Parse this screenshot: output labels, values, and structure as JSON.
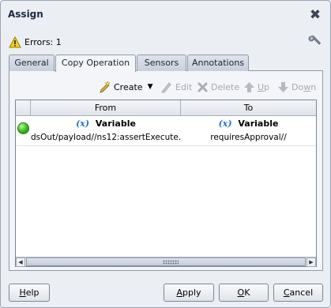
{
  "dialog": {
    "title": "Assign",
    "errors_label": "Errors: 1"
  },
  "tabs": [
    {
      "label": "General",
      "active": false
    },
    {
      "label": "Copy Operation",
      "active": true
    },
    {
      "label": "Sensors",
      "active": false
    },
    {
      "label": "Annotations",
      "active": false
    }
  ],
  "toolbar": {
    "create": {
      "label": "Create",
      "icon": "create-icon"
    },
    "edit": {
      "label": "Edit",
      "icon": "pencil-icon",
      "enabled": false
    },
    "delete": {
      "label": "Delete",
      "icon": "delete-icon",
      "enabled": false
    },
    "up": {
      "label": "Up",
      "icon": "arrow-up-icon",
      "enabled": false
    },
    "down": {
      "label": "Down",
      "icon": "arrow-down-icon",
      "enabled": false
    }
  },
  "table": {
    "columns": [
      "From",
      "To"
    ],
    "rows": [
      {
        "status": "valid",
        "from": {
          "type_icon": "(x)",
          "type": "Variable",
          "path": "dsOut/payload//ns12:assertExecute..."
        },
        "to": {
          "type_icon": "(x)",
          "type": "Variable",
          "path": "requiresApproval//"
        }
      }
    ]
  },
  "buttons": {
    "help": "Help",
    "apply": "Apply",
    "ok": "OK",
    "cancel": "Cancel"
  },
  "colors": {
    "dialog_bg": "#ebeef3",
    "variable_icon": "#2670c9",
    "status_ok": "#35b81a"
  }
}
